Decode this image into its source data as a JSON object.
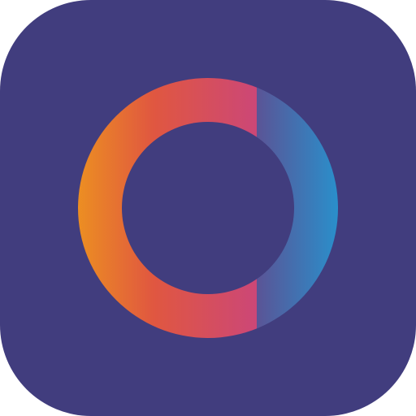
{
  "app_icon": {
    "icon": "ring-logo-icon",
    "colors": {
      "background": "#413D7E",
      "ring_orange": "#EC8E22",
      "ring_red": "#E05740",
      "ring_pink": "#CC4777",
      "ring_purple_blue": "#5A5496",
      "ring_blue": "#2A8FCB"
    }
  }
}
